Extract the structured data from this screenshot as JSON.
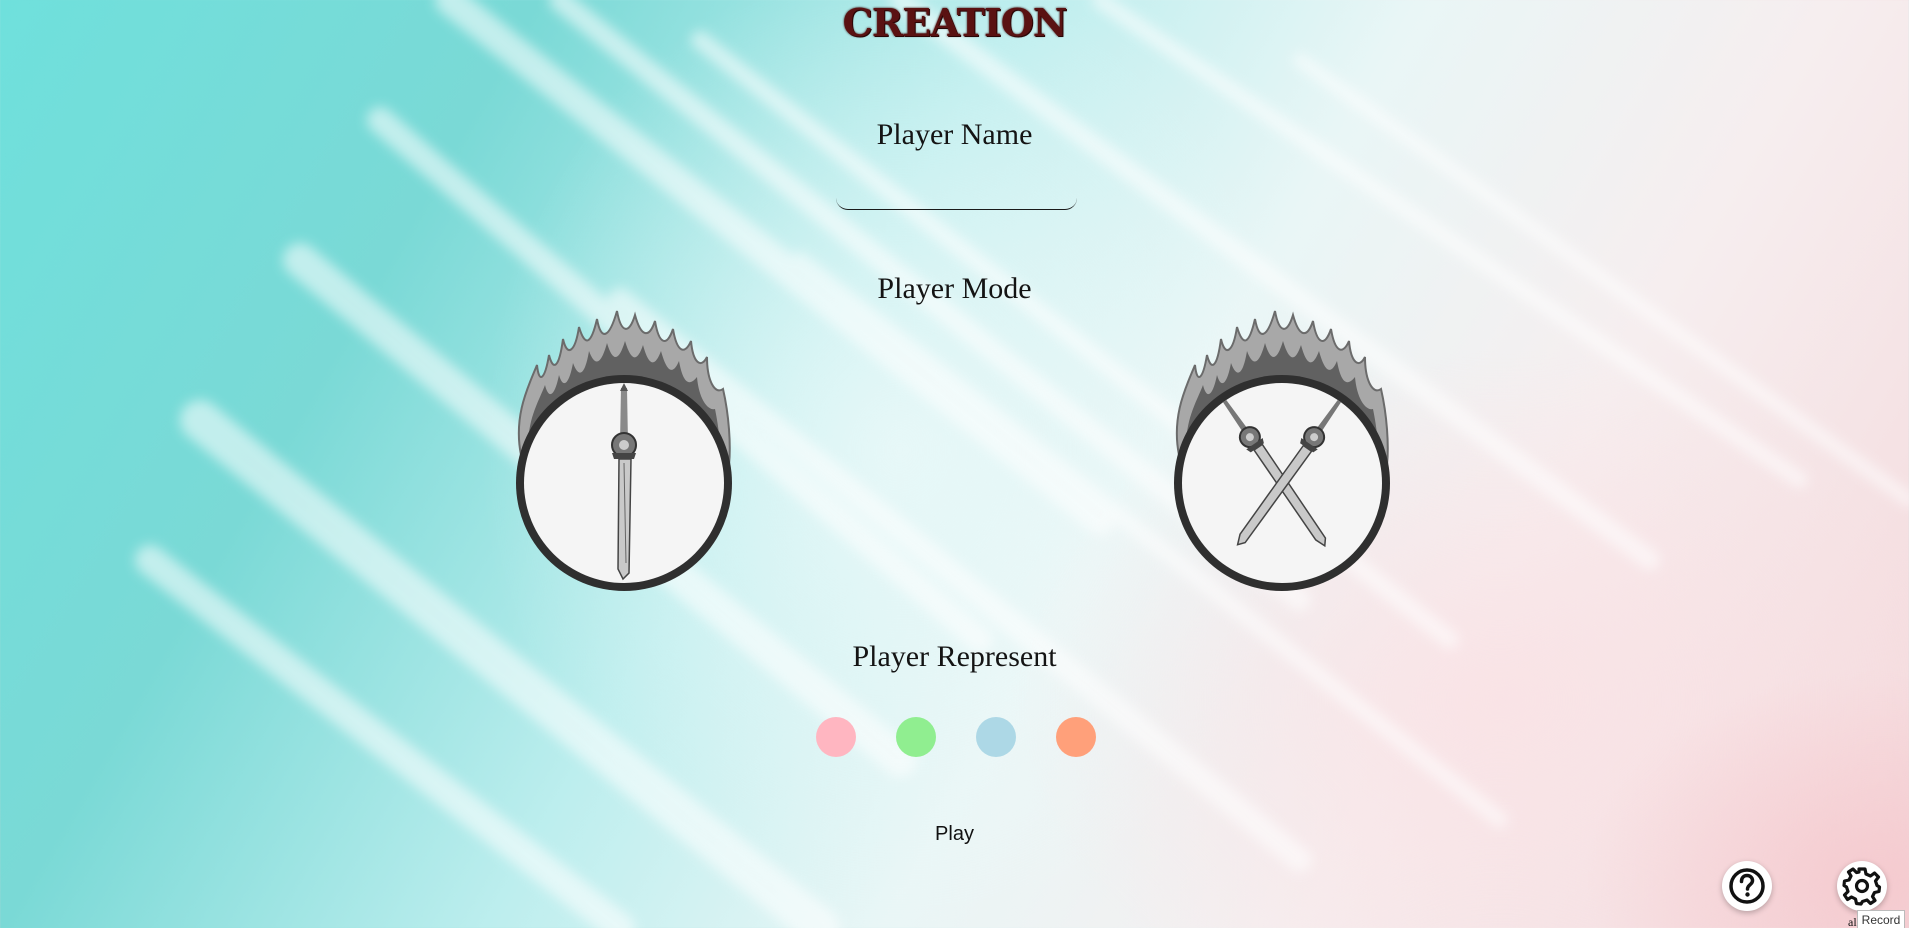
{
  "title": "CREATION",
  "player_name": {
    "label": "Player Name",
    "value": "",
    "placeholder": ""
  },
  "player_mode": {
    "label": "Player Mode",
    "options": [
      {
        "icon": "single-sword-icon"
      },
      {
        "icon": "crossed-swords-icon"
      }
    ]
  },
  "player_represent": {
    "label": "Player Represent",
    "colors": [
      "#ffb6c1",
      "#90ee90",
      "#add8e6",
      "#ffa07a"
    ]
  },
  "play_label": "Play",
  "corner": {
    "help_icon": "help-icon",
    "settings_icon": "gear-icon",
    "partial_text": "al",
    "tooltip": "Record"
  }
}
